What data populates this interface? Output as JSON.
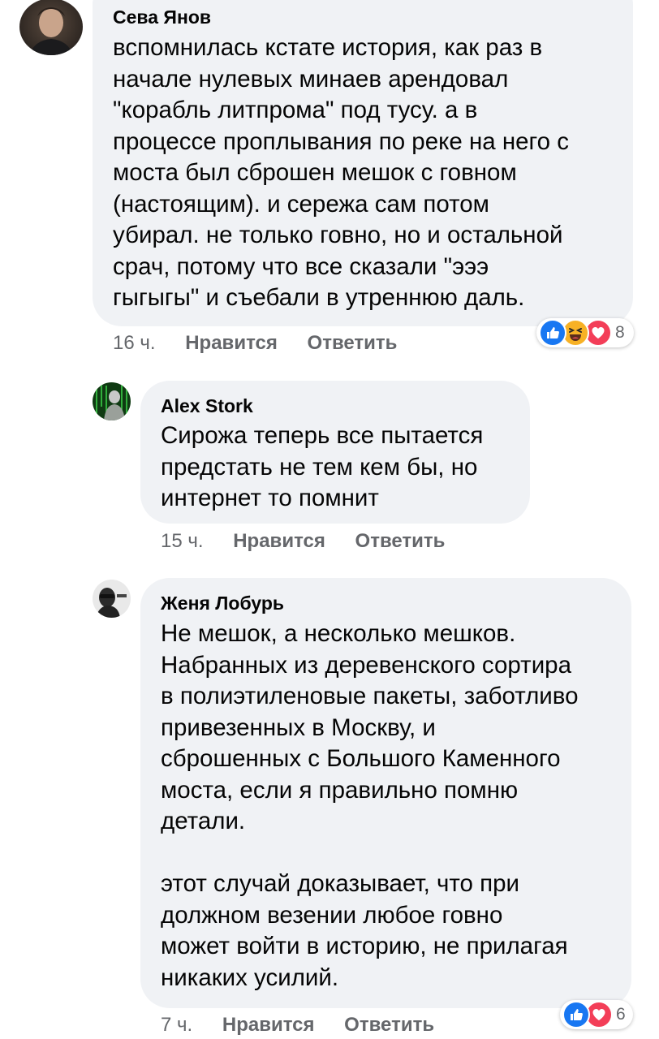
{
  "colors": {
    "bubble_bg": "#f0f2f5",
    "meta_text": "#65676b",
    "like_blue": "#1877f2",
    "love_red": "#f33e58",
    "haha_yellow": "#f7b125"
  },
  "comments": [
    {
      "author": "Сева Янов",
      "text": "вспомнилась кстате история, как раз в\nначале нулевых минаев арендовал\n\"корабль литпрома\" под тусу. а в\nпроцессе проплывания по реке на него с\nмоста был сброшен мешок с говном\n(настоящим). и сережа сам потом\nубирал. не только говно, но и остальной\nсрач, потому что все сказали \"эээ\nгыгыгы\" и съебали в утреннюю даль.",
      "time": "16 ч.",
      "like_label": "Нравится",
      "reply_label": "Ответить",
      "reactions": [
        "like-icon",
        "haha-icon",
        "love-icon"
      ],
      "reaction_count": "8"
    },
    {
      "author": "Alex Stork",
      "text": "Сирожа теперь все пытается\nпредстать не тем кем бы, но\nинтернет то помнит",
      "time": "15 ч.",
      "like_label": "Нравится",
      "reply_label": "Ответить"
    },
    {
      "author": "Женя Лобурь",
      "text": "Не мешок, а несколько мешков.\nНабранных из деревенского сортира\nв полиэтиленовые пакеты, заботливо\nпривезенных в Москву, и\nсброшенных с Большого Каменного\nмоста, если я правильно помню\nдетали.\n\nэтот случай доказывает, что при\nдолжном везении любое говно\nможет войти в историю, не прилагая\nникаких усилий.",
      "time": "7 ч.",
      "like_label": "Нравится",
      "reply_label": "Ответить",
      "reactions": [
        "like-icon",
        "love-icon"
      ],
      "reaction_count": "6"
    }
  ]
}
